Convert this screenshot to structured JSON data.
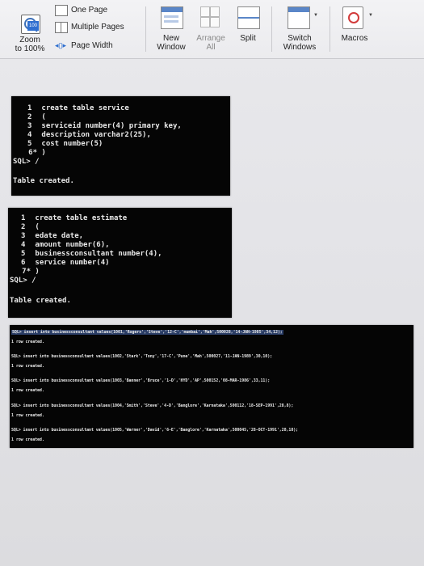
{
  "ribbon": {
    "one_page": "One Page",
    "multiple_pages": "Multiple Pages",
    "page_width": "Page Width",
    "zoom_line1": "Zoom",
    "zoom_line2": "to 100%",
    "new_window_line1": "New",
    "new_window_line2": "Window",
    "arrange_all_line1": "Arrange",
    "arrange_all_line2": "All",
    "split": "Split",
    "switch_windows_line1": "Switch",
    "switch_windows_line2": "Windows",
    "macros": "Macros"
  },
  "terminal1": {
    "lines": [
      {
        "num": "1",
        "text": "create table service"
      },
      {
        "num": "2",
        "text": "("
      },
      {
        "num": "3",
        "text": "serviceid number(4) primary key,"
      },
      {
        "num": "4",
        "text": "description varchar2(25),"
      },
      {
        "num": "5",
        "text": "cost number(5)"
      },
      {
        "num": "6*",
        "text": ")"
      },
      {
        "num": "",
        "text": "SQL> /"
      },
      {
        "num": "",
        "text": ""
      },
      {
        "num": "",
        "text": "Table created."
      }
    ]
  },
  "terminal2": {
    "lines": [
      {
        "num": "1",
        "text": "create table estimate"
      },
      {
        "num": "2",
        "text": "("
      },
      {
        "num": "3",
        "text": "edate date,"
      },
      {
        "num": "4",
        "text": "amount number(6),"
      },
      {
        "num": "5",
        "text": "businessconsultant number(4),"
      },
      {
        "num": "6",
        "text": "service number(4)"
      },
      {
        "num": "7*",
        "text": ")"
      },
      {
        "num": "",
        "text": "SQL> /"
      },
      {
        "num": "",
        "text": ""
      },
      {
        "num": "",
        "text": "Table created."
      }
    ]
  },
  "terminal3": {
    "lines": [
      "SQL> insert into businessconsultant values(1001,'Rogers','Steve','12-C','mumbai','Mah',500028,'14-JAN-1985',34,12);",
      "1 row created.",
      "SQL> insert into businessconsultant values(1002,'Stark','Tony','17-C','Pune','Mah',500027,'11-JAN-1989',30,10);",
      "1 row created.",
      "SQL> insert into businessconsultant values(1003,'Banner','Bruce','1-D','HYD','AP',500152,'08-MAR-1986',33,11);",
      "1 row created.",
      "SQL> insert into businessconsultant values(1004,'Smith','Steve','4-D','Banglore','Karnataka',500112,'18-SEP-1991',28,8);",
      "1 row created.",
      "SQL> insert into businessconsultant values(1005,'Warner','David','6-E','Banglore','Karnataka',500045,'28-OCT-1991',28,10);",
      "1 row created."
    ]
  },
  "colors": {
    "terminal_bg": "#050505",
    "terminal_text": "#e8e8e8",
    "ribbon_bg": "#efeff2",
    "accent": "#2f6fd0"
  }
}
